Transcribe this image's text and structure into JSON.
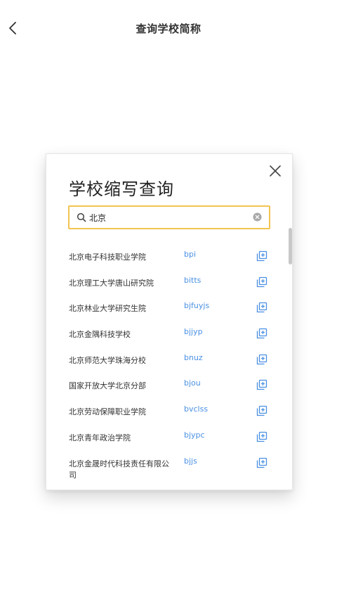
{
  "header": {
    "title": "查询学校简称"
  },
  "dialog": {
    "title": "学校缩写查询",
    "search": {
      "value": "北京",
      "placeholder": ""
    },
    "results": [
      {
        "name": "北京电子科技职业学院",
        "abbr": "bpi"
      },
      {
        "name": "北京理工大学唐山研究院",
        "abbr": "bitts"
      },
      {
        "name": "北京林业大学研究生院",
        "abbr": "bjfuyjs"
      },
      {
        "name": "北京金隅科技学校",
        "abbr": "bjjyp"
      },
      {
        "name": "北京师范大学珠海分校",
        "abbr": "bnuz"
      },
      {
        "name": "国家开放大学北京分部",
        "abbr": "bjou"
      },
      {
        "name": "北京劳动保障职业学院",
        "abbr": "bvclss"
      },
      {
        "name": "北京青年政治学院",
        "abbr": "bjypc"
      },
      {
        "name": "北京金晟时代科技责任有限公司",
        "abbr": "bjjs"
      }
    ]
  },
  "colors": {
    "accent_border": "#f2c451",
    "abbr_text": "#4a90e2",
    "copy_icon": "#4a90e2"
  },
  "icons": {
    "back": "chevron-left-icon",
    "close": "close-icon",
    "search": "search-icon",
    "clear": "clear-icon",
    "copy": "copy-add-icon"
  }
}
